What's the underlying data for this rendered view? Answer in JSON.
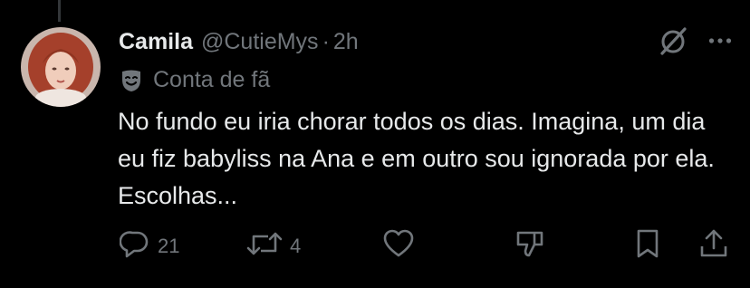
{
  "tweet": {
    "author": {
      "display_name": "Camila",
      "handle": "@CutieMys",
      "separator": "·",
      "time": "2h"
    },
    "label": {
      "icon": "theater-masks-icon",
      "text": "Conta de fã"
    },
    "text": "No fundo eu iria chorar todos os dias. Imagina, um dia eu fiz babyliss na Ana e em outro sou ignorada por ela. Escolhas...",
    "header_icons": [
      "grok-icon",
      "more-icon"
    ],
    "actions": {
      "reply": {
        "icon": "reply-icon",
        "count": "21"
      },
      "retweet": {
        "icon": "retweet-icon",
        "count": "4"
      },
      "like": {
        "icon": "like-icon",
        "count": ""
      },
      "dislike": {
        "icon": "dislike-icon",
        "count": ""
      },
      "bookmark": {
        "icon": "bookmark-icon",
        "count": ""
      },
      "share": {
        "icon": "share-icon",
        "count": ""
      }
    }
  },
  "colors": {
    "background": "#000000",
    "text_primary": "#e7e9ea",
    "text_secondary": "#71767b",
    "thread_line": "#333639"
  }
}
